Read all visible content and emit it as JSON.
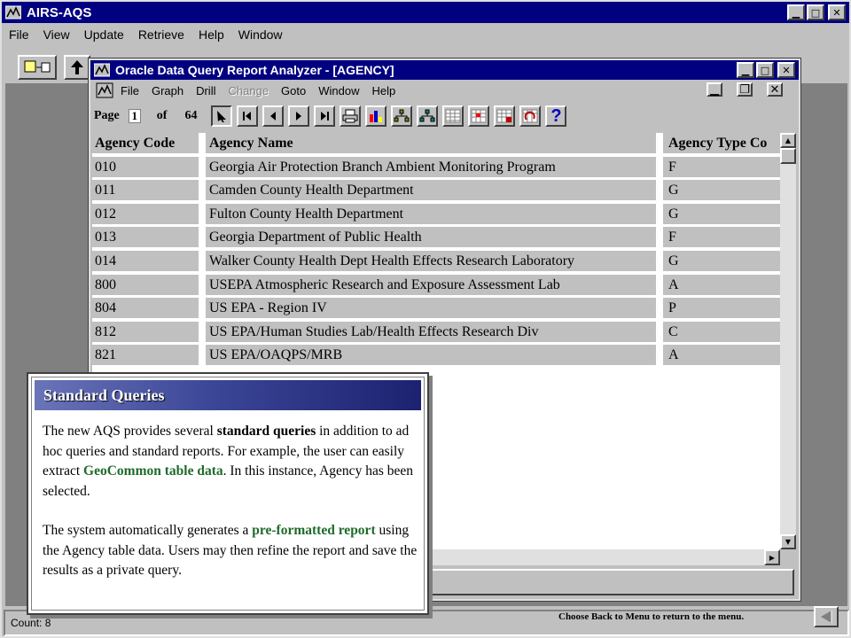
{
  "app": {
    "title": "AIRS-AQS",
    "menu": [
      "File",
      "View",
      "Update",
      "Retrieve",
      "Help",
      "Window"
    ],
    "status_text": "Count: 8"
  },
  "analyzer": {
    "title": "Oracle Data Query Report Analyzer - [AGENCY]",
    "menu": [
      "File",
      "Graph",
      "Drill",
      "Change",
      "Goto",
      "Window",
      "Help"
    ],
    "menu_disabled": [
      "Change"
    ],
    "page_label": "Page",
    "page_current": "1",
    "of_label": "of",
    "page_total": "64",
    "toolbar_icons": [
      "pointer-icon",
      "first-page-icon",
      "prev-page-icon",
      "next-page-icon",
      "last-page-icon",
      "print-icon",
      "bar-chart-icon",
      "drill-down-icon",
      "drill-up-icon",
      "table-icon",
      "pivot-icon",
      "format-icon",
      "refresh-icon",
      "help-icon"
    ]
  },
  "report": {
    "columns": [
      "Agency Code",
      "Agency Name",
      "Agency Type Co"
    ],
    "rows": [
      [
        "010",
        "Georgia Air Protection Branch Ambient Monitoring Program",
        "F"
      ],
      [
        "011",
        "Camden County Health Department",
        "G"
      ],
      [
        "012",
        "Fulton County Health Department",
        "G"
      ],
      [
        "013",
        "Georgia Department of Public Health",
        "F"
      ],
      [
        "014",
        "Walker County Health Dept Health Effects Research Laboratory",
        "G"
      ],
      [
        "800",
        "USEPA Atmospheric Research and Exposure Assessment Lab",
        "A"
      ],
      [
        "804",
        "US EPA - Region IV",
        "P"
      ],
      [
        "812",
        "US EPA/Human Studies Lab/Health Effects Research Div",
        "C"
      ],
      [
        "821",
        "US EPA/OAQPS/MRB",
        "A"
      ]
    ]
  },
  "callout": {
    "title": "Standard Queries",
    "p1_a": "The new AQS provides several ",
    "p1_b": "standard queries",
    "p1_c": " in addition to ad hoc queries and standard reports.  For example, the user can easily extract ",
    "p1_d": "GeoCommon table data",
    "p1_e": ".  In this instance, Agency has been selected.",
    "p2_a": "The system automatically generates a ",
    "p2_b": "pre-formatted report",
    "p2_c": " using the Agency table data.  Users may then refine the report and save the results as a private query."
  },
  "footer": {
    "hint": "Choose Back to Menu to return to the menu."
  },
  "colors": {
    "titlebar": "#000080",
    "face": "#c0c0c0",
    "callout_green": "#1f6b2a",
    "callout_header": "#3c4797"
  }
}
